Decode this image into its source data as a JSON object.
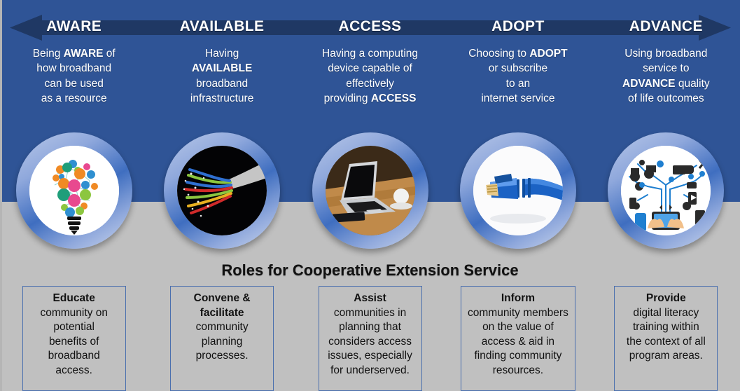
{
  "colors": {
    "panel_blue": "#2f5496",
    "arrow_navy": "#1f3864",
    "background_gray": "#c0c0c0",
    "box_border": "#4a6fae",
    "title_text": "#ffffff",
    "body_text": "#111111"
  },
  "arrow": {
    "name": "double-headed-progression-arrow",
    "direction": "both"
  },
  "stages": [
    {
      "title": "AWARE",
      "desc_lines": [
        [
          {
            "t": "Being ",
            "b": false
          },
          {
            "t": "AWARE",
            "b": true
          },
          {
            "t": " of",
            "b": false
          }
        ],
        [
          {
            "t": "how broadband",
            "b": false
          }
        ],
        [
          {
            "t": "can be used",
            "b": false
          }
        ],
        [
          {
            "t": "as a resource",
            "b": false
          }
        ]
      ],
      "image_name": "lightbulb-of-icons-image"
    },
    {
      "title": "AVAILABLE",
      "desc_lines": [
        [
          {
            "t": "Having",
            "b": false
          }
        ],
        [
          {
            "t": "AVAILABLE",
            "b": true
          }
        ],
        [
          {
            "t": "broadband",
            "b": false
          }
        ],
        [
          {
            "t": "infrastructure",
            "b": false
          }
        ]
      ],
      "image_name": "fiber-optic-cable-image"
    },
    {
      "title": "ACCESS",
      "desc_lines": [
        [
          {
            "t": "Having a computing",
            "b": false
          }
        ],
        [
          {
            "t": "device capable of",
            "b": false
          }
        ],
        [
          {
            "t": "effectively",
            "b": false
          }
        ],
        [
          {
            "t": "providing ",
            "b": false
          },
          {
            "t": "ACCESS",
            "b": true
          }
        ]
      ],
      "image_name": "laptop-on-desk-image"
    },
    {
      "title": "ADOPT",
      "desc_lines": [
        [
          {
            "t": "Choosing to ",
            "b": false
          },
          {
            "t": "ADOPT",
            "b": true
          }
        ],
        [
          {
            "t": "or subscribe",
            "b": false
          }
        ],
        [
          {
            "t": "to an",
            "b": false
          }
        ],
        [
          {
            "t": "internet service",
            "b": false
          }
        ]
      ],
      "image_name": "ethernet-cable-image"
    },
    {
      "title": "ADVANCE",
      "desc_lines": [
        [
          {
            "t": "Using broadband",
            "b": false
          }
        ],
        [
          {
            "t": "service to",
            "b": false
          }
        ],
        [
          {
            "t": "ADVANCE",
            "b": true
          },
          {
            "t": " quality",
            "b": false
          }
        ],
        [
          {
            "t": "of life outcomes",
            "b": false
          }
        ]
      ],
      "image_name": "connected-devices-tablet-image"
    }
  ],
  "roles": {
    "heading": "Roles for Cooperative Extension Service",
    "boxes": [
      {
        "lines": [
          [
            {
              "t": "Educate",
              "b": true
            }
          ],
          [
            {
              "t": "community on",
              "b": false
            }
          ],
          [
            {
              "t": "potential",
              "b": false
            }
          ],
          [
            {
              "t": "benefits of",
              "b": false
            }
          ],
          [
            {
              "t": "broadband",
              "b": false
            }
          ],
          [
            {
              "t": "access.",
              "b": false
            }
          ]
        ]
      },
      {
        "lines": [
          [
            {
              "t": "Convene &",
              "b": true
            }
          ],
          [
            {
              "t": "facilitate",
              "b": true
            }
          ],
          [
            {
              "t": "community",
              "b": false
            }
          ],
          [
            {
              "t": "planning",
              "b": false
            }
          ],
          [
            {
              "t": "processes.",
              "b": false
            }
          ]
        ]
      },
      {
        "lines": [
          [
            {
              "t": "Assist",
              "b": true
            }
          ],
          [
            {
              "t": "communities in",
              "b": false
            }
          ],
          [
            {
              "t": "planning that",
              "b": false
            }
          ],
          [
            {
              "t": "considers access",
              "b": false
            }
          ],
          [
            {
              "t": "issues, especially",
              "b": false
            }
          ],
          [
            {
              "t": "for underserved.",
              "b": false
            }
          ]
        ]
      },
      {
        "lines": [
          [
            {
              "t": "Inform",
              "b": true
            }
          ],
          [
            {
              "t": "community members",
              "b": false
            }
          ],
          [
            {
              "t": "on the value of",
              "b": false
            }
          ],
          [
            {
              "t": "access & aid in",
              "b": false
            }
          ],
          [
            {
              "t": "finding community",
              "b": false
            }
          ],
          [
            {
              "t": "resources.",
              "b": false
            }
          ]
        ]
      },
      {
        "lines": [
          [
            {
              "t": "Provide",
              "b": true
            }
          ],
          [
            {
              "t": "digital literacy",
              "b": false
            }
          ],
          [
            {
              "t": "training within",
              "b": false
            }
          ],
          [
            {
              "t": "the context of all",
              "b": false
            }
          ],
          [
            {
              "t": "program areas.",
              "b": false
            }
          ]
        ]
      }
    ]
  }
}
